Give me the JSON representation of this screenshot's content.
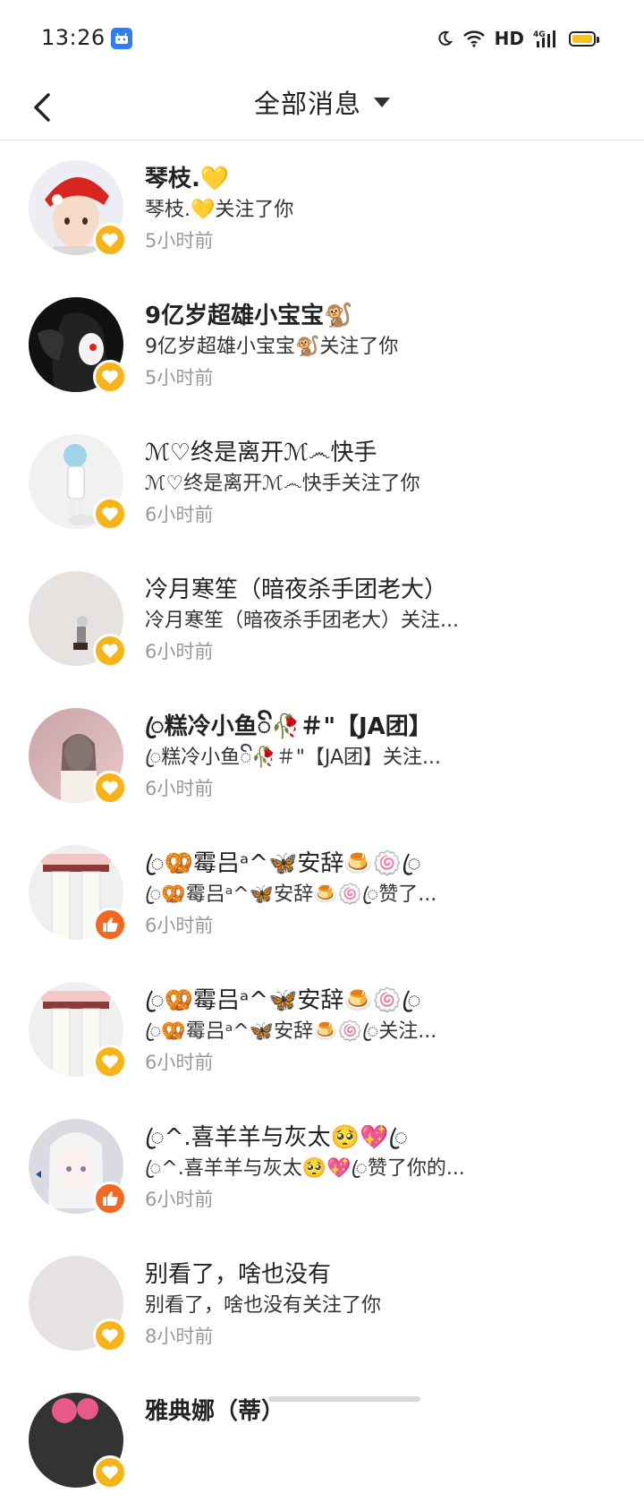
{
  "status": {
    "time": "13:26",
    "network": "HD",
    "signal_label": "4G"
  },
  "header": {
    "title": "全部消息"
  },
  "messages": [
    {
      "name": "琴枝.💛",
      "desc": "琴枝.💛关注了你",
      "ago": "5小时前",
      "type": "follow"
    },
    {
      "name": "9亿岁超雄小宝宝🐒",
      "desc": "9亿岁超雄小宝宝🐒关注了你",
      "ago": "5小时前",
      "type": "follow"
    },
    {
      "name": "ℳ♡终是离开ℳ෴快手",
      "desc": "ℳ♡终是离开ℳ෴快手关注了你",
      "ago": "6小时前",
      "type": "follow"
    },
    {
      "name": "冷月寒笙（暗夜杀手团老大）",
      "desc": "冷月寒笙（暗夜杀手团老大）关注...",
      "ago": "6小时前",
      "type": "follow"
    },
    {
      "name": "ꦿ糕冷小鱼ꦼ🥀＃\"【JA团】",
      "desc": "ꦿ糕冷小鱼ꦼ🥀＃\"【JA团】关注...",
      "ago": "6小时前",
      "type": "follow"
    },
    {
      "name": "ꦿ🥨霉吕ᵃ^🦋安辞🍮🍥ꦿ",
      "desc": "ꦿ🥨霉吕ᵃ^🦋安辞🍮🍥ꦿ赞了...",
      "ago": "6小时前",
      "type": "like"
    },
    {
      "name": "ꦿ🥨霉吕ᵃ^🦋安辞🍮🍥ꦿ",
      "desc": "ꦿ🥨霉吕ᵃ^🦋安辞🍮🍥ꦿ关注...",
      "ago": "6小时前",
      "type": "follow"
    },
    {
      "name": "ꦿ^.喜羊羊与灰太🥺💖ꦿ",
      "desc": "ꦿ^.喜羊羊与灰太🥺💖ꦿ赞了你的...",
      "ago": "6小时前",
      "type": "like"
    },
    {
      "name": "别看了，啥也没有",
      "desc": "别看了，啥也没有关注了你",
      "ago": "8小时前",
      "type": "follow"
    },
    {
      "name": "雅典娜（蒂）",
      "desc": "",
      "ago": "",
      "type": "follow"
    }
  ],
  "colors": {
    "follow_badge": "#f7b418",
    "like_badge": "#f26722",
    "divider": "#e9e9e9"
  }
}
